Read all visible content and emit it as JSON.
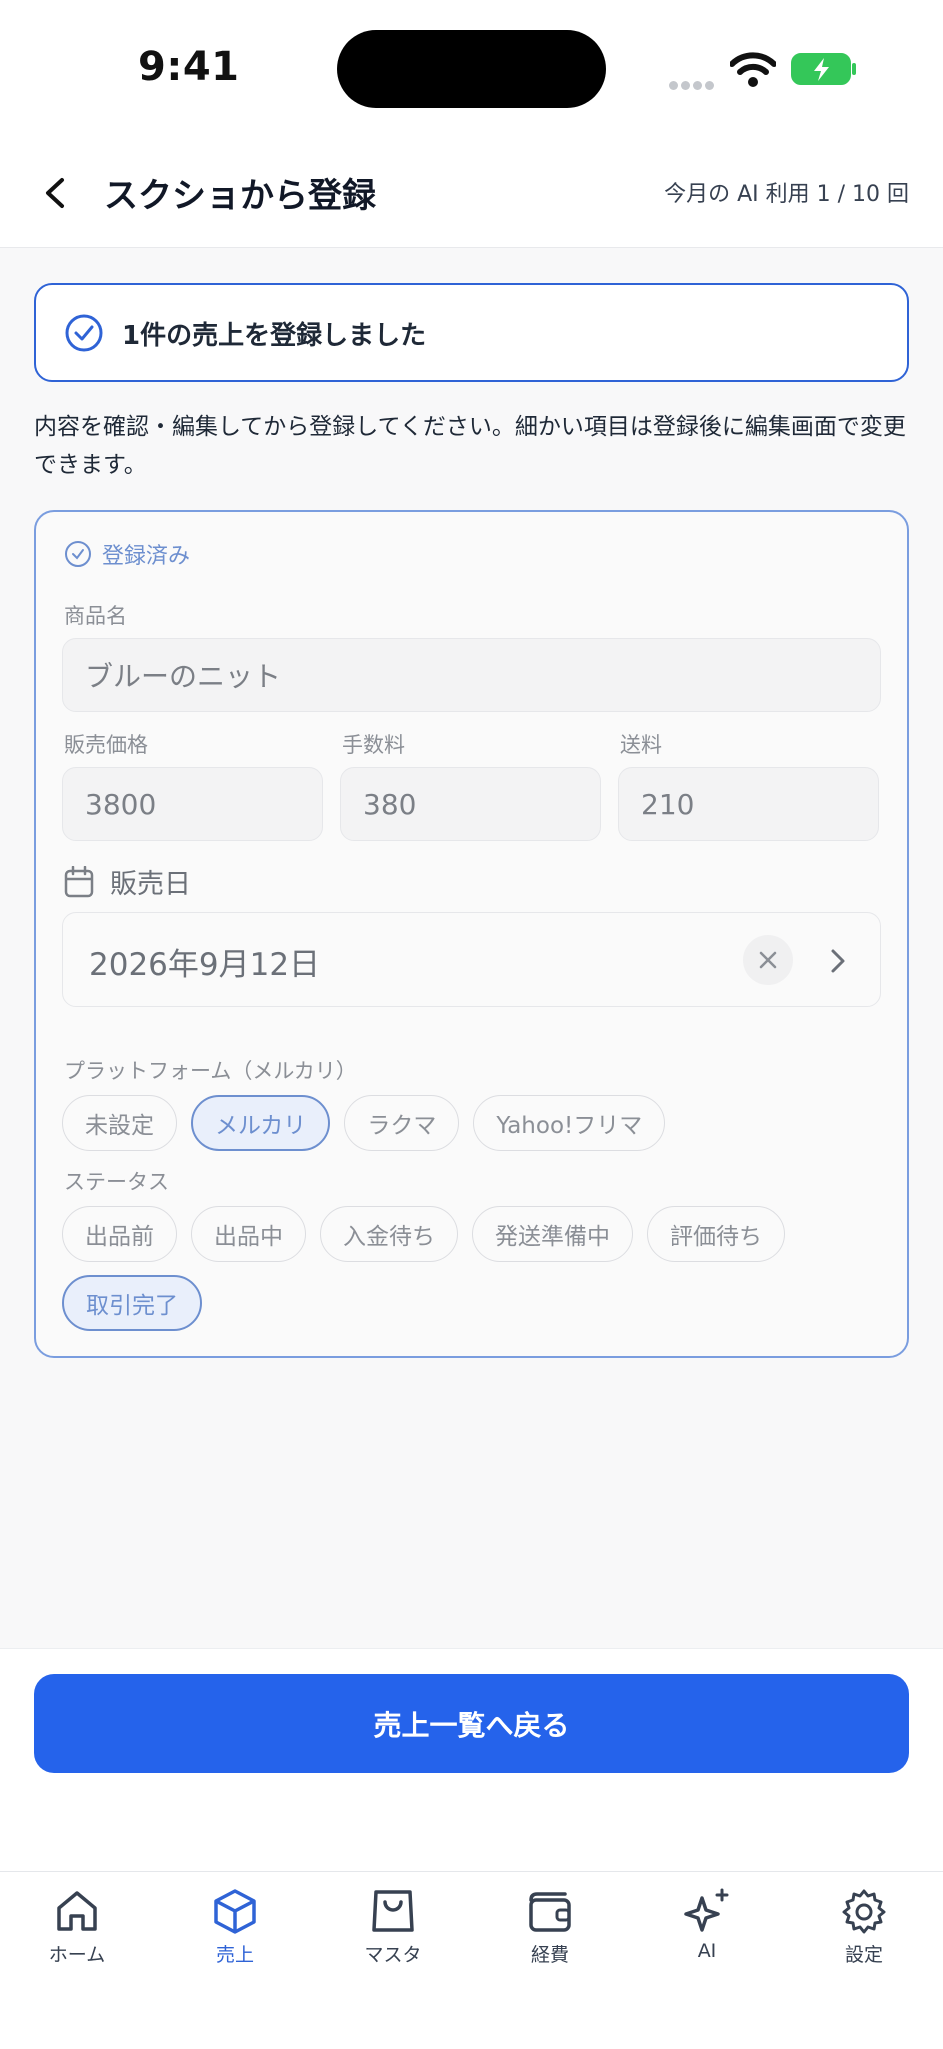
{
  "status_bar": {
    "time": "9:41"
  },
  "header": {
    "title": "スクショから登録",
    "ai_usage": "今月の AI 利用 1 / 10 回"
  },
  "banner": {
    "text": "1件の売上を登録しました"
  },
  "description": "内容を確認・編集してから登録してください。細かい項目は登録後に編集画面で変更できます。",
  "card": {
    "status": "登録済み",
    "product_name_label": "商品名",
    "product_name": "ブルーのニット",
    "price_label": "販売価格",
    "price": "3800",
    "fee_label": "手数料",
    "fee": "380",
    "shipping_label": "送料",
    "shipping": "210",
    "date_label": "販売日",
    "date": "2026年9月12日",
    "platform_label": "プラットフォーム（メルカリ）",
    "platforms": [
      "未設定",
      "メルカリ",
      "ラクマ",
      "Yahoo!フリマ"
    ],
    "selected_platform": "メルカリ",
    "status_label": "ステータス",
    "statuses": [
      "出品前",
      "出品中",
      "入金待ち",
      "発送準備中",
      "評価待ち",
      "取引完了"
    ],
    "selected_status": "取引完了"
  },
  "action": {
    "back_to_list": "売上一覧へ戻る"
  },
  "tabbar": {
    "items": [
      {
        "label": "ホーム",
        "icon": "home-icon"
      },
      {
        "label": "売上",
        "icon": "box-icon"
      },
      {
        "label": "マスタ",
        "icon": "bag-icon"
      },
      {
        "label": "経費",
        "icon": "wallet-icon"
      },
      {
        "label": "AI",
        "icon": "sparkle-icon"
      },
      {
        "label": "設定",
        "icon": "gear-icon"
      }
    ],
    "active": "売上"
  },
  "colors": {
    "accent": "#2563eb",
    "muted_accent": "#6d8fcf"
  }
}
